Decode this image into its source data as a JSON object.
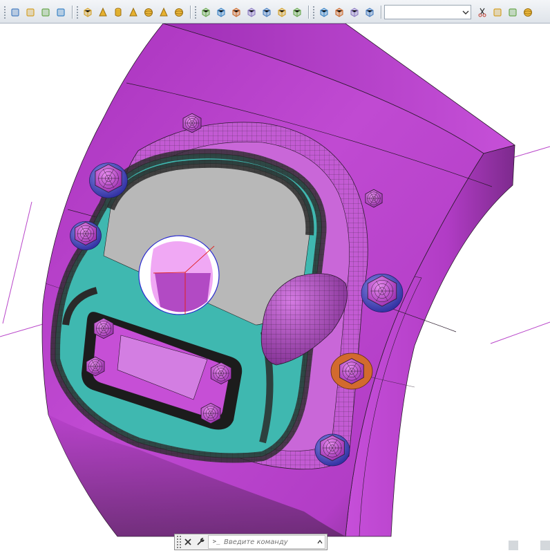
{
  "toolbar": {
    "groups": [
      {
        "name": "visual-styles",
        "icons": [
          "2d-wireframe-icon",
          "3d-wireframe-icon",
          "hidden-icon",
          "realistic-icon"
        ]
      },
      {
        "name": "3d-primitives",
        "icons": [
          "box-icon",
          "wedge-icon",
          "cylinder-icon",
          "cone-icon",
          "sphere-icon",
          "pyramid-icon",
          "torus-icon"
        ]
      },
      {
        "name": "views",
        "icons": [
          "named-views-icon",
          "top-view-icon",
          "bottom-view-icon",
          "left-view-icon",
          "right-view-icon",
          "front-view-icon",
          "back-view-icon"
        ]
      },
      {
        "name": "isometric",
        "icons": [
          "sw-iso-icon",
          "se-iso-icon",
          "ne-iso-icon",
          "nw-iso-icon"
        ]
      },
      {
        "name": "camera",
        "icons": [
          "camera-icon",
          "ucs-icon"
        ]
      }
    ],
    "view_select": {
      "value": ""
    },
    "right_icons": [
      "scissors-icon",
      "paste-icon",
      "match-properties-icon",
      "color-wheel-icon"
    ]
  },
  "command_line": {
    "placeholder": "Введите команду",
    "prompt_symbol": ">_"
  },
  "colors": {
    "body_magenta": "#b43ec8",
    "face_teal": "#3fb8b0",
    "face_gray": "#b8b8b8",
    "bolt_blue": "#4b4bc8",
    "bolt_orange": "#d26a2e",
    "frame_dark": "#2c2c2c",
    "toolbar_bg": "#e6eaef"
  }
}
